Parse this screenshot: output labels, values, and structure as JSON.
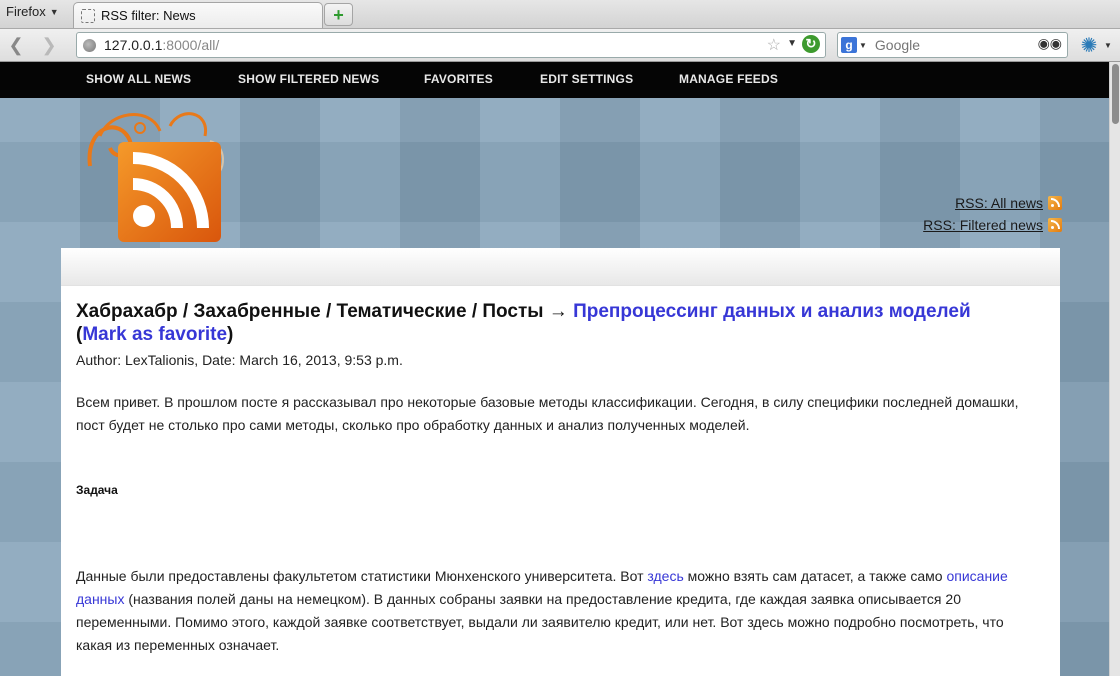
{
  "browser": {
    "app_menu": "Firefox",
    "tab_title": "RSS filter: News",
    "url_host": "127.0.0.1",
    "url_rest": ":8000/all/",
    "search_placeholder": "Google",
    "search_engine_letter": "g"
  },
  "nav": {
    "items": [
      "SHOW ALL NEWS",
      "SHOW FILTERED NEWS",
      "FAVORITES",
      "EDIT SETTINGS",
      "MANAGE FEEDS"
    ]
  },
  "rss_links": {
    "all": "RSS: All news",
    "filtered": "RSS: Filtered news"
  },
  "post": {
    "breadcrumb": "Хабрахабр / Захабренные / Тематические / Посты →",
    "title_link": "Препроцессинг данных и анализ моделей",
    "paren_open": " (",
    "favorite_link": "Mark as favorite",
    "paren_close": ")",
    "meta": "Author: LexTalionis, Date: March 16, 2013, 9:53 p.m.",
    "intro": "Всем привет. В прошлом посте я рассказывал про некоторые базовые методы классификации. Сегодня, в силу специфики последней домашки, пост будет не столько про сами методы, сколько про обработку данных и анализ полученных моделей.",
    "heading": "Задача",
    "body_1": "Данные были предоставлены факультетом статистики Мюнхенского университета. Вот ",
    "link_here": "здесь",
    "body_2": " можно взять сам датасет, а также само ",
    "link_description": "описание данных",
    "body_3": " (названия полей даны на немецком). В данных собраны заявки на предоставление кредита, где каждая заявка описывается 20 переменными. Помимо этого, каждой заявке соответствует, выдали ли заявителю кредит, или нет. Вот здесь можно подробно посмотреть, что какая из переменных означает."
  },
  "colors": {
    "menu_bg": "#050505",
    "link": "#3737d6",
    "rss_orange": "#e8791a",
    "page_bg": "#86a3b9"
  }
}
